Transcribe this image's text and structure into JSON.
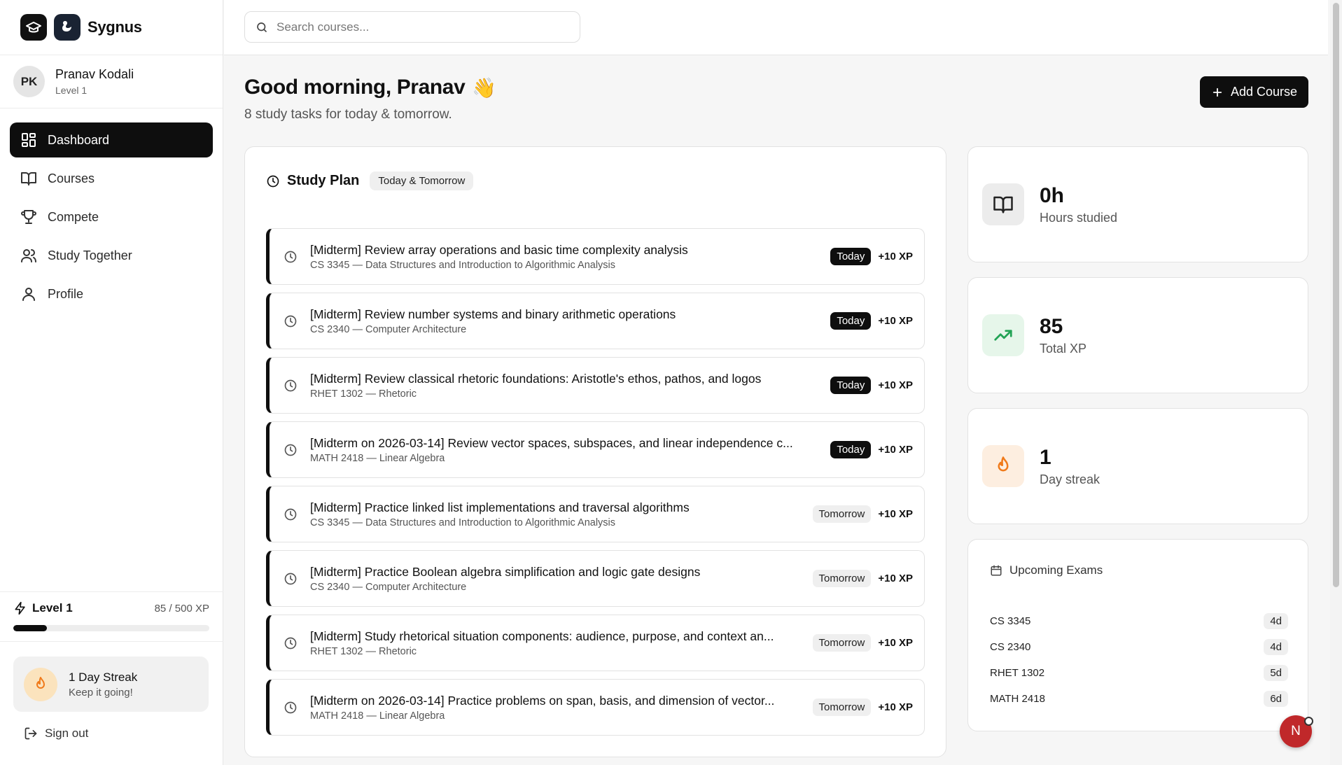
{
  "brand": {
    "name": "Sygnus"
  },
  "user": {
    "initials": "PK",
    "name": "Pranav Kodali",
    "level": "Level 1"
  },
  "nav": [
    {
      "label": "Dashboard",
      "icon": "dashboard-icon",
      "active": true
    },
    {
      "label": "Courses",
      "icon": "book-icon",
      "active": false
    },
    {
      "label": "Compete",
      "icon": "trophy-icon",
      "active": false
    },
    {
      "label": "Study Together",
      "icon": "users-icon",
      "active": false
    },
    {
      "label": "Profile",
      "icon": "user-icon",
      "active": false
    }
  ],
  "level": {
    "label": "Level 1",
    "xp_text": "85 / 500 XP",
    "progress_fraction": 0.17
  },
  "streak": {
    "title": "1 Day Streak",
    "subtitle": "Keep it going!"
  },
  "signout": {
    "label": "Sign out"
  },
  "search": {
    "placeholder": "Search courses..."
  },
  "header": {
    "greeting": "Good morning, Pranav",
    "wave": "👋",
    "subtitle": "8 study tasks for today & tomorrow.",
    "add_course": "Add Course"
  },
  "plan": {
    "title": "Study Plan",
    "chip": "Today & Tomorrow",
    "tasks": [
      {
        "title": "[Midterm] Review array operations and basic time complexity analysis",
        "course": "CS 3345 — Data Structures and Introduction to Algorithmic Analysis",
        "when": "Today",
        "xp": "+10 XP"
      },
      {
        "title": "[Midterm] Review number systems and binary arithmetic operations",
        "course": "CS 2340 — Computer Architecture",
        "when": "Today",
        "xp": "+10 XP"
      },
      {
        "title": "[Midterm] Review classical rhetoric foundations: Aristotle's ethos, pathos, and logos",
        "course": "RHET 1302 — Rhetoric",
        "when": "Today",
        "xp": "+10 XP"
      },
      {
        "title": "[Midterm on 2026-03-14] Review vector spaces, subspaces, and linear independence c...",
        "course": "MATH 2418 — Linear Algebra",
        "when": "Today",
        "xp": "+10 XP"
      },
      {
        "title": "[Midterm] Practice linked list implementations and traversal algorithms",
        "course": "CS 3345 — Data Structures and Introduction to Algorithmic Analysis",
        "when": "Tomorrow",
        "xp": "+10 XP"
      },
      {
        "title": "[Midterm] Practice Boolean algebra simplification and logic gate designs",
        "course": "CS 2340 — Computer Architecture",
        "when": "Tomorrow",
        "xp": "+10 XP"
      },
      {
        "title": "[Midterm] Study rhetorical situation components: audience, purpose, and context an...",
        "course": "RHET 1302 — Rhetoric",
        "when": "Tomorrow",
        "xp": "+10 XP"
      },
      {
        "title": "[Midterm on 2026-03-14] Practice problems on span, basis, and dimension of vector...",
        "course": "MATH 2418 — Linear Algebra",
        "when": "Tomorrow",
        "xp": "+10 XP"
      }
    ]
  },
  "stats": [
    {
      "value": "0h",
      "label": "Hours studied",
      "icon": "book-open-icon",
      "icon_bg": "#ececec",
      "icon_color": "#222222"
    },
    {
      "value": "85",
      "label": "Total XP",
      "icon": "trending-up-icon",
      "icon_bg": "#e6f6ea",
      "icon_color": "#22a355"
    },
    {
      "value": "1",
      "label": "Day streak",
      "icon": "flame-icon",
      "icon_bg": "#fdeee0",
      "icon_color": "#f07a1a"
    }
  ],
  "exams": {
    "title": "Upcoming Exams",
    "items": [
      {
        "course": "CS 3345",
        "days": "4d"
      },
      {
        "course": "CS 2340",
        "days": "4d"
      },
      {
        "course": "RHET 1302",
        "days": "5d"
      },
      {
        "course": "MATH 2418",
        "days": "6d"
      }
    ]
  },
  "fab": {
    "letter": "N"
  },
  "colors": {
    "primary": "#0e0e0e",
    "streak_bg": "#fbe3bd",
    "fab": "#c0282a"
  }
}
